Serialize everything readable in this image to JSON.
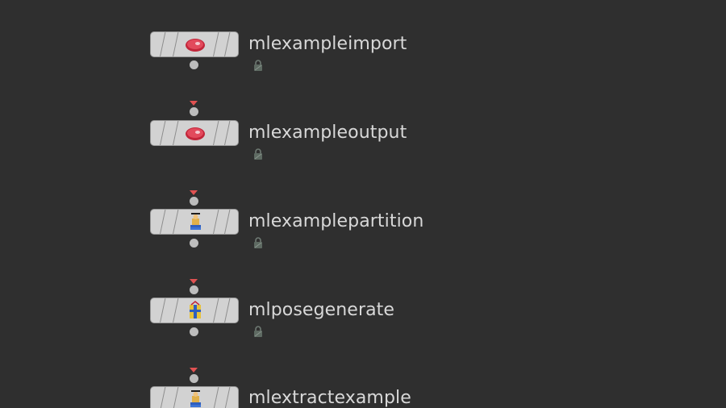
{
  "network": {
    "nodes": [
      {
        "name": "mlexampleimport",
        "icon": "meat-icon",
        "locked": true,
        "has_input": false,
        "has_output": true
      },
      {
        "name": "mlexampleoutput",
        "icon": "meat-icon",
        "locked": true,
        "has_input": true,
        "has_output": false
      },
      {
        "name": "mlexamplepartition",
        "icon": "scholar-books-icon",
        "locked": true,
        "has_input": true,
        "has_output": true
      },
      {
        "name": "mlposegenerate",
        "icon": "gift-figure-icon",
        "locked": true,
        "has_input": true,
        "has_output": true
      },
      {
        "name": "mlextractexample",
        "icon": "scholar-books-icon",
        "locked": false,
        "has_input": true,
        "has_output": false
      }
    ]
  },
  "colors": {
    "background": "#2f2f2f",
    "node_body": "#d2d2d2",
    "input_marker": "#e05252",
    "connector": "#bdbdbd",
    "label": "#d8d8d8"
  }
}
